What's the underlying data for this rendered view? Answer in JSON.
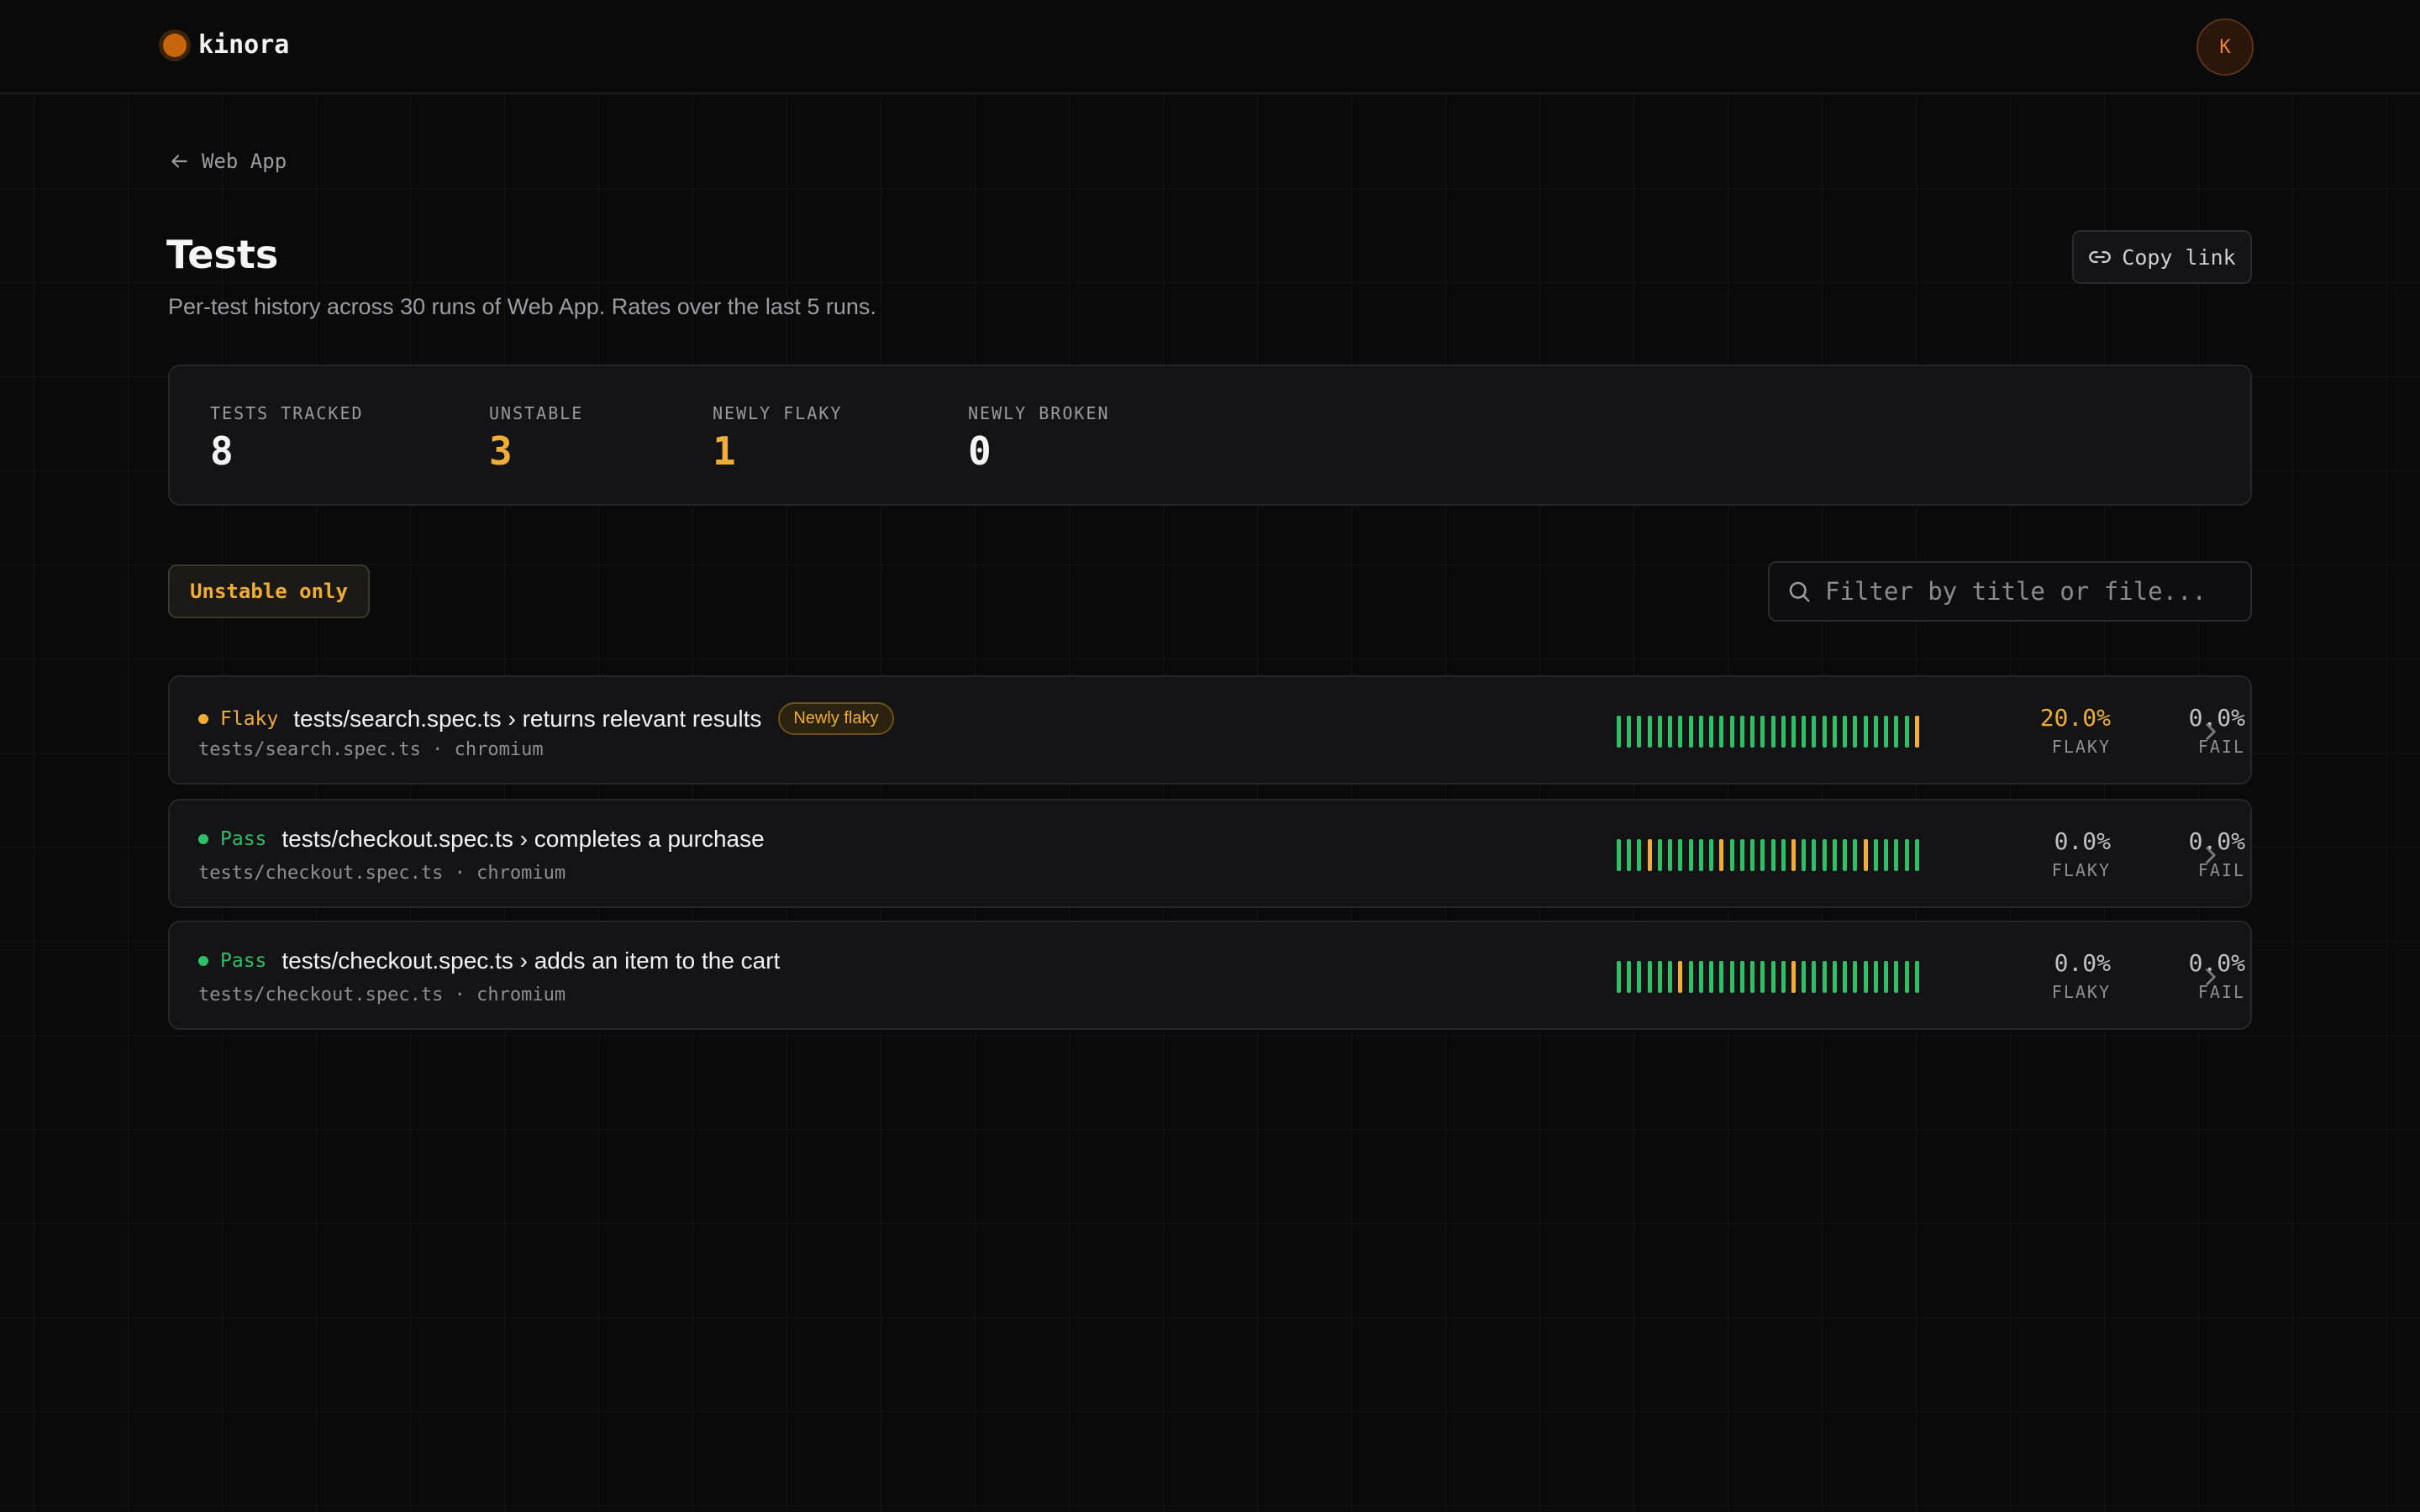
{
  "app": {
    "name": "kinora",
    "avatar_initial": "K"
  },
  "breadcrumb": {
    "back_label": "Web App"
  },
  "page": {
    "title": "Tests",
    "subtitle": "Per-test history across 30 runs of Web App. Rates over the last 5 runs.",
    "copy_link_label": "Copy link"
  },
  "stats": [
    {
      "label": "TESTS TRACKED",
      "value": "8",
      "tone": "white"
    },
    {
      "label": "UNSTABLE",
      "value": "3",
      "tone": "amber"
    },
    {
      "label": "NEWLY FLAKY",
      "value": "1",
      "tone": "amber"
    },
    {
      "label": "NEWLY BROKEN",
      "value": "0",
      "tone": "white"
    }
  ],
  "filters": {
    "unstable_only_label": "Unstable only",
    "search_placeholder": "Filter by title or file..."
  },
  "colors": {
    "pass": "#2fbf67",
    "flaky": "#f0ad37",
    "amber": "#f0ad37",
    "muted": "#c2c2c6"
  },
  "tests": [
    {
      "status": "Flaky",
      "title": "tests/search.spec.ts › returns relevant results",
      "badge": "Newly flaky",
      "meta": "tests/search.spec.ts · chromium",
      "flaky_rate": "20.0%",
      "fail_rate": "0.0%",
      "flaky_label": "FLAKY",
      "fail_label": "FAIL",
      "history": [
        "pass",
        "pass",
        "pass",
        "pass",
        "pass",
        "pass",
        "pass",
        "pass",
        "pass",
        "pass",
        "pass",
        "pass",
        "pass",
        "pass",
        "pass",
        "pass",
        "pass",
        "pass",
        "pass",
        "pass",
        "pass",
        "pass",
        "pass",
        "pass",
        "pass",
        "pass",
        "pass",
        "pass",
        "pass",
        "flaky"
      ]
    },
    {
      "status": "Pass",
      "title": "tests/checkout.spec.ts › completes a purchase",
      "badge": "",
      "meta": "tests/checkout.spec.ts · chromium",
      "flaky_rate": "0.0%",
      "fail_rate": "0.0%",
      "flaky_label": "FLAKY",
      "fail_label": "FAIL",
      "history": [
        "pass",
        "pass",
        "pass",
        "flaky",
        "pass",
        "pass",
        "pass",
        "pass",
        "pass",
        "pass",
        "flaky",
        "pass",
        "pass",
        "pass",
        "pass",
        "pass",
        "pass",
        "flaky",
        "pass",
        "pass",
        "pass",
        "pass",
        "pass",
        "pass",
        "flaky",
        "pass",
        "pass",
        "pass",
        "pass",
        "pass"
      ]
    },
    {
      "status": "Pass",
      "title": "tests/checkout.spec.ts › adds an item to the cart",
      "badge": "",
      "meta": "tests/checkout.spec.ts · chromium",
      "flaky_rate": "0.0%",
      "fail_rate": "0.0%",
      "flaky_label": "FLAKY",
      "fail_label": "FAIL",
      "history": [
        "pass",
        "pass",
        "pass",
        "pass",
        "pass",
        "pass",
        "flaky",
        "pass",
        "pass",
        "pass",
        "pass",
        "pass",
        "pass",
        "pass",
        "pass",
        "pass",
        "pass",
        "flaky",
        "pass",
        "pass",
        "pass",
        "pass",
        "pass",
        "pass",
        "pass",
        "pass",
        "pass",
        "pass",
        "pass",
        "pass"
      ]
    }
  ]
}
